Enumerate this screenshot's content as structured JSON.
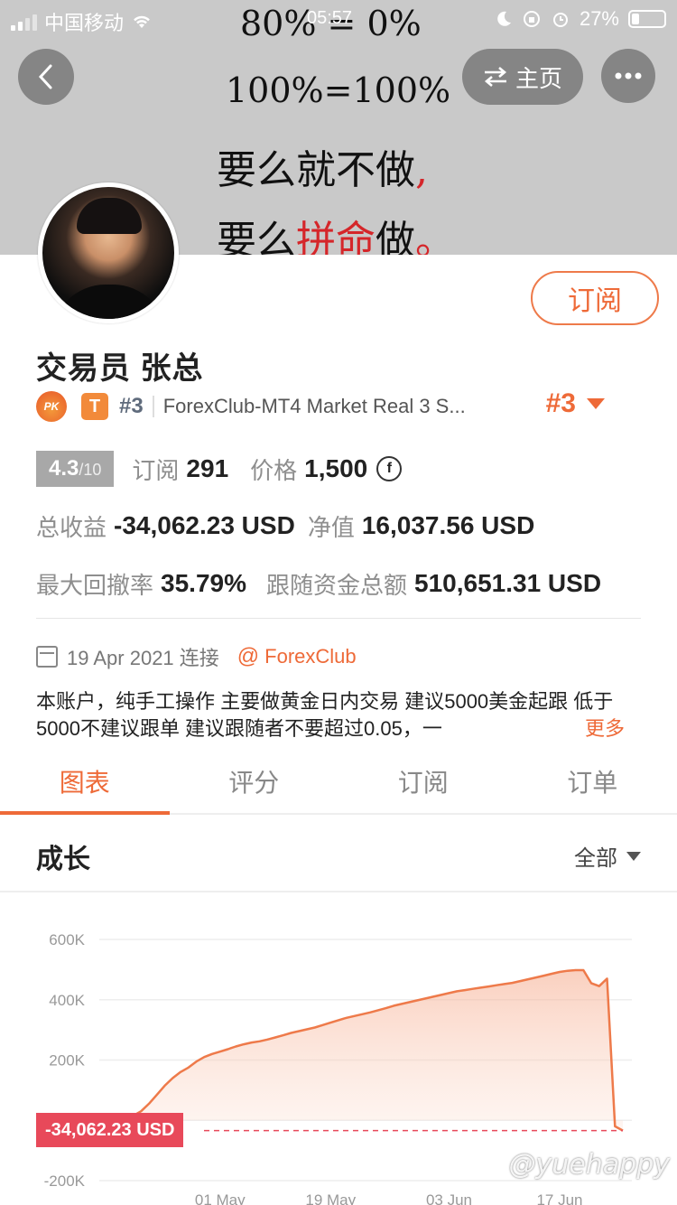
{
  "status_bar": {
    "carrier": "中国移动",
    "time": "05:57",
    "battery": "27%"
  },
  "banner": {
    "line1": "80% = 0%",
    "line2": "100%=100%",
    "line3_main": "要么就不做",
    "line3_punct": ",",
    "line4_a": "要么",
    "line4_b": "拼命",
    "line4_c": "做",
    "line4_punct": "。"
  },
  "nav": {
    "home_label": "主页"
  },
  "profile": {
    "subscribe_label": "订阅",
    "name": "交易员  张总",
    "pk_badge": "PK",
    "t_badge": "T",
    "rank_small": "#3",
    "server": "ForexClub-MT4 Market Real 3 S...",
    "rank_big": "#3"
  },
  "stats": {
    "score": "4.3",
    "score_total": "/10",
    "subscribers_label": "订阅",
    "subscribers": "291",
    "price_label": "价格",
    "price": "1,500",
    "total_profit_label": "总收益",
    "total_profit": "-34,062.23 USD",
    "equity_label": "净值",
    "equity": "16,037.56 USD",
    "max_drawdown_label": "最大回撤率",
    "max_drawdown": "35.79%",
    "follow_funds_label": "跟随资金总额",
    "follow_funds": "510,651.31 USD"
  },
  "meta": {
    "date": "19 Apr 2021 连接",
    "at": "@",
    "broker": "ForexClub"
  },
  "description": {
    "text": "本账户，纯手工操作 主要做黄金日内交易   建议5000美金起跟  低于5000不建议跟单 建议跟随者不要超过0.05，一",
    "more": "更多"
  },
  "tabs": [
    {
      "label": "图表"
    },
    {
      "label": "评分"
    },
    {
      "label": "订阅"
    },
    {
      "label": "订单"
    }
  ],
  "section": {
    "title": "成长",
    "range": "全部"
  },
  "current_value_tag": "-34,062.23 USD",
  "watermark": "@yuehappy",
  "chart_data": {
    "type": "area",
    "title": "",
    "y_ticks": [
      "600K",
      "400K",
      "200K",
      "-200K"
    ],
    "x_ticks": [
      "01 May",
      "19 May",
      "03 Jun",
      "17 Jun"
    ],
    "ylim": [
      -200000,
      600000
    ],
    "grid": true,
    "color": "#ee7a4a",
    "x": [
      0,
      1,
      2,
      3,
      4,
      5,
      6,
      7,
      8,
      9,
      10,
      11,
      12,
      13,
      14,
      15,
      16,
      17,
      18,
      19,
      20,
      21,
      22,
      23,
      24,
      25,
      26,
      27,
      28,
      29,
      30,
      31,
      32,
      33,
      34,
      35,
      36,
      37,
      38,
      39,
      40,
      41,
      42,
      43,
      44,
      45,
      46,
      47,
      48,
      49,
      50,
      51,
      52,
      53,
      54,
      55,
      56,
      57,
      58,
      59,
      60,
      61,
      62,
      63,
      64
    ],
    "values": [
      0,
      5000,
      15000,
      30000,
      55000,
      85000,
      115000,
      140000,
      160000,
      175000,
      195000,
      210000,
      220000,
      228000,
      236000,
      245000,
      252000,
      258000,
      262000,
      268000,
      275000,
      282000,
      290000,
      296000,
      302000,
      308000,
      316000,
      324000,
      332000,
      340000,
      346000,
      352000,
      358000,
      365000,
      372000,
      380000,
      386000,
      392000,
      398000,
      404000,
      410000,
      416000,
      422000,
      428000,
      432000,
      436000,
      440000,
      444000,
      448000,
      452000,
      456000,
      462000,
      468000,
      474000,
      480000,
      486000,
      492000,
      496000,
      498000,
      498000,
      455000,
      445000,
      470000,
      -20000,
      -34062
    ],
    "x_tick_positions": [
      13,
      27,
      42,
      56
    ],
    "reference_value": -34062.23
  }
}
